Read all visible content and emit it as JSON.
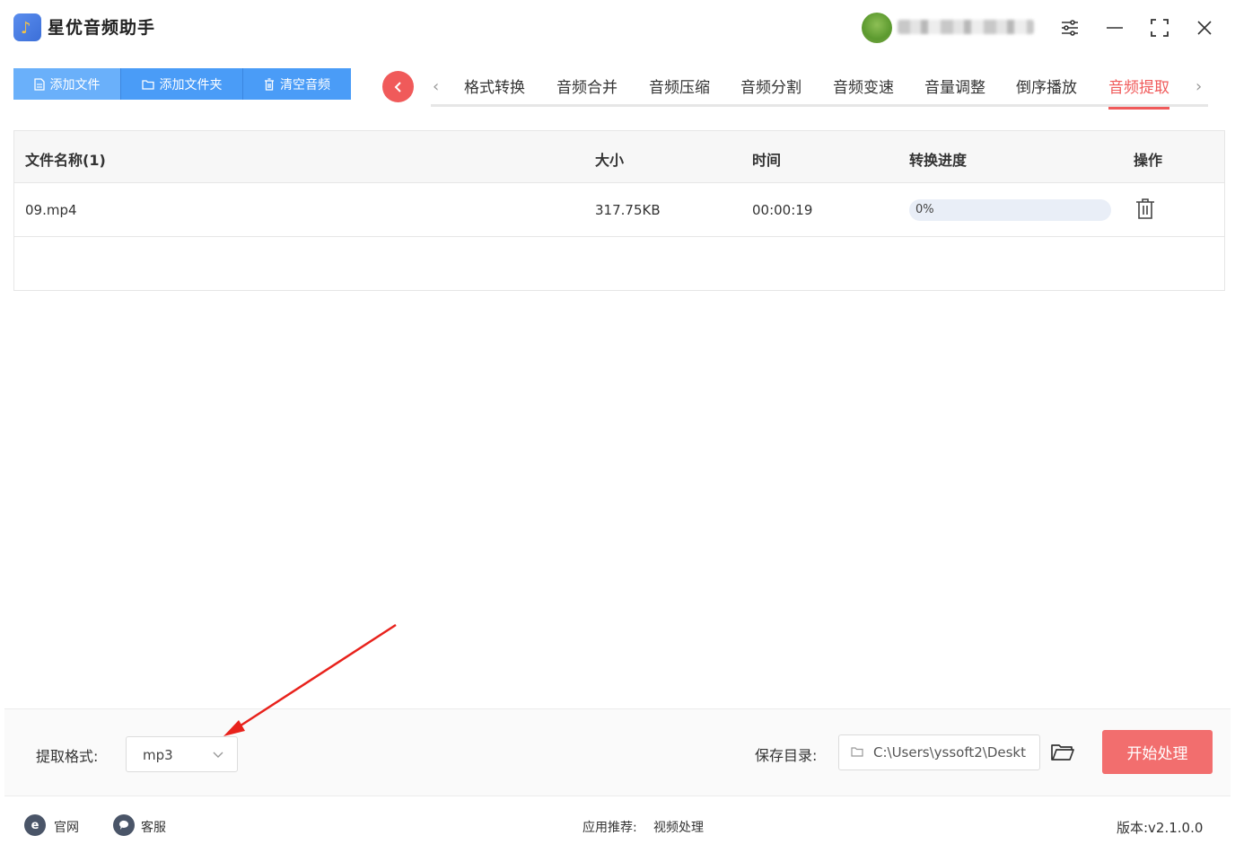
{
  "app": {
    "title": "星优音频助手"
  },
  "toolbar": {
    "add_file": "添加文件",
    "add_folder": "添加文件夹",
    "clear_audio": "清空音频"
  },
  "tabs": [
    {
      "label": "格式转换"
    },
    {
      "label": "音频合并"
    },
    {
      "label": "音频压缩"
    },
    {
      "label": "音频分割"
    },
    {
      "label": "音频变速"
    },
    {
      "label": "音量调整"
    },
    {
      "label": "倒序播放"
    },
    {
      "label": "音频提取",
      "active": true
    }
  ],
  "table": {
    "headers": {
      "name": "文件名称(1)",
      "size": "大小",
      "time": "时间",
      "progress": "转换进度",
      "action": "操作"
    },
    "rows": [
      {
        "name": "09.mp4",
        "size": "317.75KB",
        "time": "00:00:19",
        "progress_text": "0%",
        "progress_fraction": 0
      }
    ]
  },
  "settings": {
    "format_label": "提取格式:",
    "format_value": "mp3",
    "save_dir_label": "保存目录:",
    "save_dir_value": "C:\\Users\\yssoft2\\Deskt",
    "start_button": "开始处理"
  },
  "footer": {
    "website": "官网",
    "support": "客服",
    "recommend_label": "应用推荐:",
    "recommend_value": "视频处理",
    "version": "版本:v2.1.0.0"
  },
  "colors": {
    "primary_blue": "#4a9cf7",
    "accent_red": "#f05a5a",
    "start_button": "#f26e6e"
  }
}
